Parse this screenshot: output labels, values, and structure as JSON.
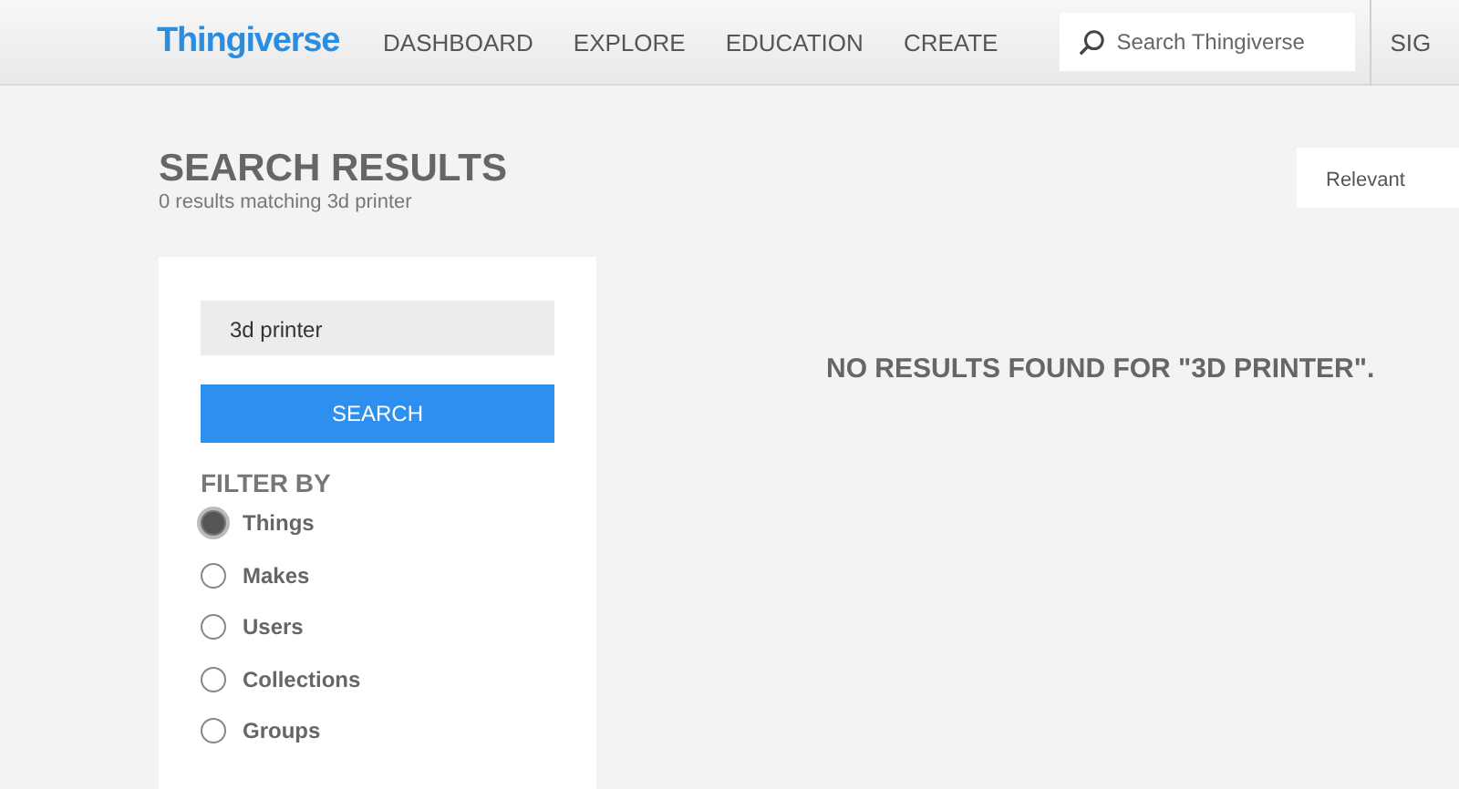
{
  "header": {
    "logo": "Thingiverse",
    "nav": [
      {
        "label": "DASHBOARD"
      },
      {
        "label": "EXPLORE"
      },
      {
        "label": "EDUCATION"
      },
      {
        "label": "CREATE"
      }
    ],
    "search": {
      "placeholder": "Search Thingiverse"
    },
    "sign_in": "SIG"
  },
  "page": {
    "title": "SEARCH RESULTS",
    "subtitle": "0 results matching 3d printer"
  },
  "sort": {
    "value": "Relevant"
  },
  "sidebar": {
    "search_field": {
      "value": "3d printer"
    },
    "search_button": "SEARCH",
    "filter_heading": "FILTER BY",
    "filters": [
      {
        "label": "Things",
        "selected": true
      },
      {
        "label": "Makes",
        "selected": false
      },
      {
        "label": "Users",
        "selected": false
      },
      {
        "label": "Collections",
        "selected": false
      },
      {
        "label": "Groups",
        "selected": false
      }
    ]
  },
  "message": "NO RESULTS FOUND FOR \"3D PRINTER\"."
}
